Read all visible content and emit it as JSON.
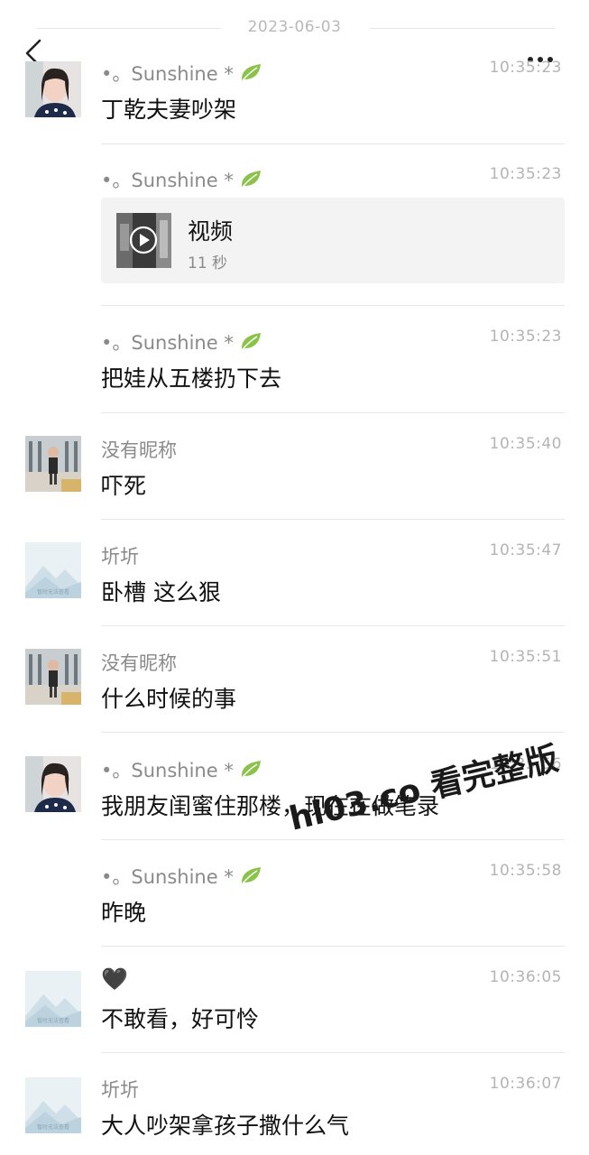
{
  "header": {
    "date": "2023-06-03"
  },
  "video": {
    "title": "视频",
    "duration": "11 秒"
  },
  "messages": [
    {
      "sender": "•。Sunshine *",
      "time": "10:35:23",
      "text": "丁乾夫妻吵架"
    },
    {
      "sender": "•。Sunshine *",
      "time": "10:35:23",
      "text": ""
    },
    {
      "sender": "•。Sunshine *",
      "time": "10:35:23",
      "text": "把娃从五楼扔下去"
    },
    {
      "sender": "没有昵称",
      "time": "10:35:40",
      "text": "吓死"
    },
    {
      "sender": "圻圻",
      "time": "10:35:47",
      "text": "卧槽 这么狠"
    },
    {
      "sender": "没有昵称",
      "time": "10:35:51",
      "text": "什么时候的事"
    },
    {
      "sender": "•。Sunshine *",
      "time": "10:35:56",
      "text": "我朋友闺蜜住那楼，现在在做笔录"
    },
    {
      "sender": "•。Sunshine *",
      "time": "10:35:58",
      "text": "昨晚"
    },
    {
      "sender": "🖤",
      "time": "10:36:05",
      "text": "不敢看，好可怜"
    },
    {
      "sender": "圻圻",
      "time": "10:36:07",
      "text": "大人吵架拿孩子撒什么气"
    }
  ],
  "watermark": "hl03.co 看完整版",
  "icons": {
    "back": "chevron-left-icon",
    "more": "more-dots-icon",
    "leaf": "leaf-icon",
    "play": "play-icon"
  },
  "colors": {
    "leaf": "#8bc34a",
    "sep": "#e7e7e7",
    "meta": "#b4b4b4"
  }
}
